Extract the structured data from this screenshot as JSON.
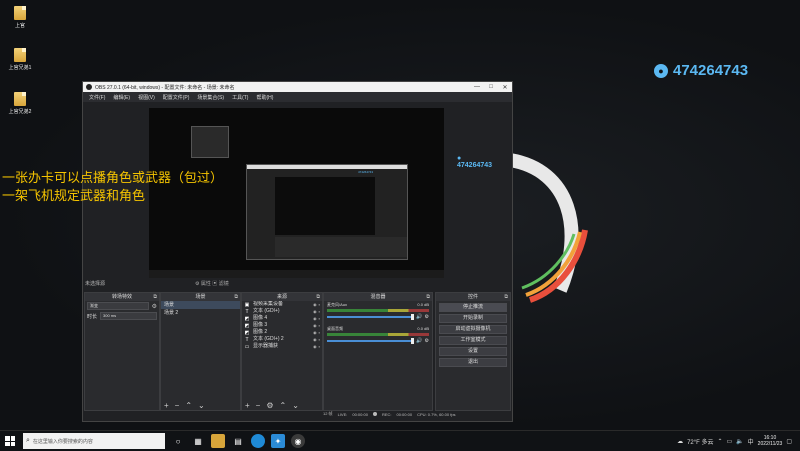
{
  "desktop": {
    "icons": [
      {
        "label": "上官"
      },
      {
        "label": "上官兄弟1"
      },
      {
        "label": "上官兄弟2"
      }
    ],
    "qq_number": "474264743"
  },
  "overlay": {
    "line1": "一张办卡可以点播角色或武器（包过）",
    "line2": "一架飞机规定武器和角色"
  },
  "obs": {
    "title": "OBS 27.0.1 (64-bit, windows) - 配置文件: 未命名 - 场景: 未命名",
    "menu": [
      "文件(F)",
      "编辑(E)",
      "视图(V)",
      "配置文件(P)",
      "场景集合(S)",
      "工具(T)",
      "帮助(H)"
    ],
    "preview_qq": "474264743",
    "scene_selected_label": "未选择源",
    "scene_props": "属性",
    "scene_filters": "滤镜",
    "transitions": {
      "header": "转场特效",
      "type": "渐变",
      "duration_label": "时长",
      "duration_value": "300 ms"
    },
    "scenes": {
      "header": "场景",
      "items": [
        "场景",
        "场景 2"
      ]
    },
    "sources": {
      "header": "来源",
      "items": [
        {
          "icon": "cam",
          "label": "视频采集设备"
        },
        {
          "icon": "T",
          "label": "文本 (GDI+)"
        },
        {
          "icon": "img",
          "label": "图像 4"
        },
        {
          "icon": "img",
          "label": "图像 3"
        },
        {
          "icon": "img",
          "label": "图像 2"
        },
        {
          "icon": "T",
          "label": "文本 (GDI+) 2"
        },
        {
          "icon": "disp",
          "label": "显示器捕获"
        }
      ]
    },
    "mixer": {
      "header": "混音器",
      "channels": [
        {
          "name": "麦克风/Aux",
          "db": "0.0 dB"
        },
        {
          "name": "桌面音频",
          "db": "0.0 dB"
        }
      ]
    },
    "controls": {
      "header": "控件",
      "buttons": [
        "停止推流",
        "开始录制",
        "启动虚拟摄像机",
        "工作室模式",
        "设置",
        "退出"
      ]
    },
    "status": {
      "live_label": "LIVE:",
      "live_time": "00:00:00",
      "rec_label": "REC:",
      "rec_time": "00:00:00",
      "cpu": "CPU: 0.7%, 60.00 fps",
      "frames": "12 帧"
    }
  },
  "taskbar": {
    "search_placeholder": "在这里输入你要搜索的内容",
    "weather": "72°F 多云",
    "time": "16:10",
    "date": "2022/11/23"
  }
}
